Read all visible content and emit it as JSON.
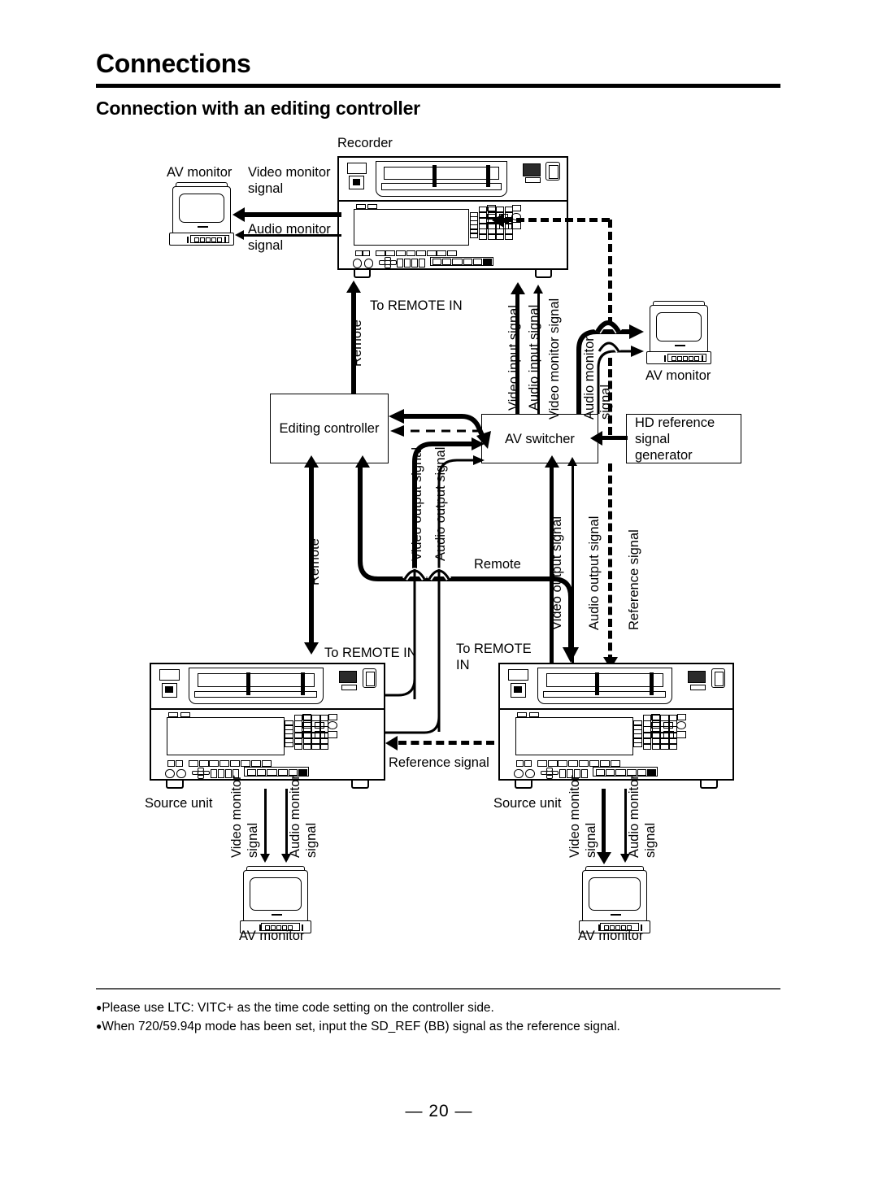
{
  "header": {
    "title": "Connections",
    "section": "Connection with an editing controller"
  },
  "diagram": {
    "devices": {
      "recorder": "Recorder",
      "editing_controller": "Editing controller",
      "av_switcher": "AV switcher",
      "hd_ref_generator": "HD reference signal generator",
      "av_monitor": "AV monitor",
      "source_unit": "Source unit"
    },
    "labels": {
      "av_monitor_topleft": "AV monitor",
      "video_monitor_signal_top": "Video monitor\nsignal",
      "audio_monitor_signal_top": "Audio monitor\nsignal",
      "to_remote_in_top": "To REMOTE IN",
      "remote_top": "Remote",
      "video_input_signal": "Video input signal",
      "audio_input_signal": "Audio input signal",
      "video_monitor_signal_sw": "Video monitor signal",
      "audio_monitor_signal_sw": "Audio monitor\nsignal",
      "av_monitor_right": "AV monitor",
      "hd_reference_signal_generator": "HD reference signal\ngenerator",
      "video_output_signal_ec": "Video output signal",
      "audio_output_signal_ec": "Audio output signal",
      "remote_left": "Remote",
      "remote_mid": "Remote",
      "to_remote_in_left": "To REMOTE IN",
      "to_remote_in_right": "To REMOTE\nIN",
      "video_output_signal_r": "Video output signal",
      "audio_output_signal_r": "Audio output signal",
      "reference_signal_v": "Reference signal",
      "reference_signal_h": "Reference signal",
      "source_unit_left": "Source unit",
      "source_unit_right": "Source unit",
      "video_monitor_signal_bl": "Video monitor\nsignal",
      "audio_monitor_signal_bl": "Audio monitor\nsignal",
      "video_monitor_signal_br": "Video monitor\nsignal",
      "audio_monitor_signal_br": "Audio monitor\nsignal",
      "av_monitor_bottom_left": "AV monitor",
      "av_monitor_bottom_right": "AV monitor"
    }
  },
  "notes": [
    "Please use LTC: VITC+ as the time code setting on the controller side.",
    "When 720/59.94p mode has been set, input the SD_REF (BB) signal as the reference signal."
  ],
  "page_number": "— 20 —",
  "colors": {
    "ink": "#000000",
    "rule": "#5a5a5a",
    "background": "#ffffff"
  }
}
